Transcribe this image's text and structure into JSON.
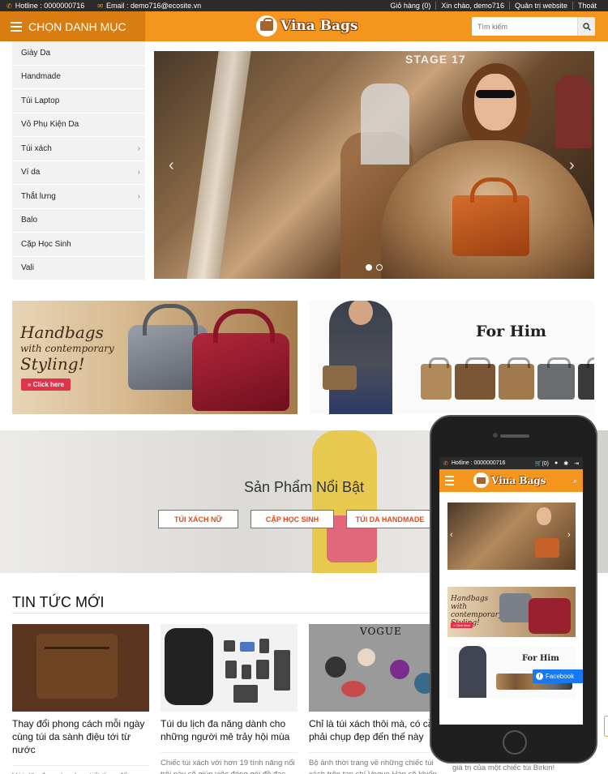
{
  "topbar": {
    "hotline": "Hotline : 0000000716",
    "email": "Email : demo716@ecosite.vn",
    "links": [
      "Giỏ hàng (0)",
      "Xin chào, demo716",
      "Quản trị website",
      "Thoát"
    ]
  },
  "header": {
    "category_label": "CHỌN DANH MỤC",
    "logo_text": "Vina Bags",
    "search_placeholder": "Tìm kiếm"
  },
  "sidebar": {
    "items": [
      {
        "label": "Giày Da",
        "has_sub": false
      },
      {
        "label": "Handmade",
        "has_sub": false
      },
      {
        "label": "Túi Laptop",
        "has_sub": false
      },
      {
        "label": "Vỏ Phụ Kiện Da",
        "has_sub": false
      },
      {
        "label": "Túi xách",
        "has_sub": true
      },
      {
        "label": "Ví da",
        "has_sub": true
      },
      {
        "label": "Thắt lưng",
        "has_sub": true
      },
      {
        "label": "Balo",
        "has_sub": false
      },
      {
        "label": "Cặp Học Sinh",
        "has_sub": false
      },
      {
        "label": "Vali",
        "has_sub": false
      }
    ]
  },
  "slider": {
    "stage_text": "STAGE 17",
    "active_dot": 0,
    "dot_count": 2
  },
  "banners": {
    "left": {
      "line1": "Handbags",
      "line2": "with contemporary",
      "line3": "Styling!",
      "cta": "» Click here"
    },
    "right": {
      "title": "For Him"
    }
  },
  "featured": {
    "title": "Sản Phẩm Nổi Bật",
    "tabs": [
      "TÚI XÁCH NỮ",
      "CẶP HỌC SINH",
      "TÚI DA HANDMADE"
    ]
  },
  "news": {
    "title": "TIN TỨC MỚI",
    "items": [
      {
        "title": "Thay đổi phong cách mỗi ngày cùng túi da sành điệu tới từ nước",
        "desc": "Với dây đeo cùng họa tiết thay đổi được, chiếc túi xách BeConvertible"
      },
      {
        "title": "Túi du lịch đa năng dành cho những người mê trảy hội mùa",
        "desc": "Chiếc túi xách với hơn 19 tính năng nổi trội này sẽ giúp việc đóng gói đồ đạc"
      },
      {
        "title": "Chỉ là túi xách thôi mà, có cần phải chụp đẹp đến thế này",
        "desc": "Bộ ảnh thời trang về những chiếc túi xách trên tạp chí Vogue Hàn sẽ khiến"
      }
    ],
    "extra_desc": "giá trị của một chiếc túi Birkin!",
    "vogue_text": "VOGUE"
  },
  "mobile": {
    "hotline": "Hotline : 0000000716",
    "cart": "(0)",
    "logo_text": "Vina Bags",
    "banner1_text": "Handbags with contemporary Styling!",
    "banner1_cta": "» Click here",
    "banner2_title": "For Him",
    "facebook_label": "Facebook"
  },
  "colors": {
    "accent": "#f4961e",
    "accent_dark": "#d97d12",
    "tab_red": "#e24a1e",
    "topbar": "#2b2b2b"
  }
}
